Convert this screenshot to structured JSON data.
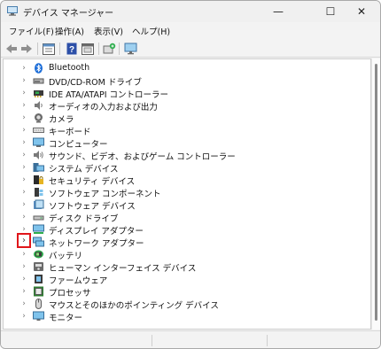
{
  "window": {
    "title": "デバイス マネージャー",
    "controls": {
      "minimize": "—",
      "maximize": "☐",
      "close": "✕"
    }
  },
  "menubar": {
    "items": [
      "ファイル(F)",
      "操作(A)",
      "表示(V)",
      "ヘルプ(H)"
    ]
  },
  "toolbar": {
    "icons": [
      "back-arrow-icon",
      "forward-arrow-icon",
      "properties-icon",
      "help-icon",
      "update-driver-icon",
      "add-hardware-icon",
      "monitor-icon"
    ]
  },
  "tree": {
    "selected_highlight_index": 14,
    "items": [
      {
        "label": "Bluetooth",
        "icon": "bluetooth-icon"
      },
      {
        "label": "DVD/CD-ROM ドライブ",
        "icon": "dvd-drive-icon"
      },
      {
        "label": "IDE ATA/ATAPI コントローラー",
        "icon": "ide-controller-icon"
      },
      {
        "label": "オーディオの入力および出力",
        "icon": "audio-icon"
      },
      {
        "label": "カメラ",
        "icon": "camera-icon"
      },
      {
        "label": "キーボード",
        "icon": "keyboard-icon"
      },
      {
        "label": "コンピューター",
        "icon": "computer-icon"
      },
      {
        "label": "サウンド、ビデオ、およびゲーム コントローラー",
        "icon": "sound-video-icon"
      },
      {
        "label": "システム デバイス",
        "icon": "system-device-icon"
      },
      {
        "label": "セキュリティ デバイス",
        "icon": "security-device-icon"
      },
      {
        "label": "ソフトウェア コンポーネント",
        "icon": "software-component-icon"
      },
      {
        "label": "ソフトウェア デバイス",
        "icon": "software-device-icon"
      },
      {
        "label": "ディスク ドライブ",
        "icon": "disk-drive-icon"
      },
      {
        "label": "ディスプレイ アダプター",
        "icon": "display-adapter-icon"
      },
      {
        "label": "ネットワーク アダプター",
        "icon": "network-adapter-icon"
      },
      {
        "label": "バッテリ",
        "icon": "battery-icon"
      },
      {
        "label": "ヒューマン インターフェイス デバイス",
        "icon": "hid-icon"
      },
      {
        "label": "ファームウェア",
        "icon": "firmware-icon"
      },
      {
        "label": "プロセッサ",
        "icon": "processor-icon"
      },
      {
        "label": "マウスとそのほかのポインティング デバイス",
        "icon": "mouse-icon"
      },
      {
        "label": "モニター",
        "icon": "monitor-device-icon"
      }
    ]
  },
  "colors": {
    "highlight_border": "#e0161b",
    "window_bg": "#f3f3f3",
    "tree_bg": "#ffffff"
  }
}
